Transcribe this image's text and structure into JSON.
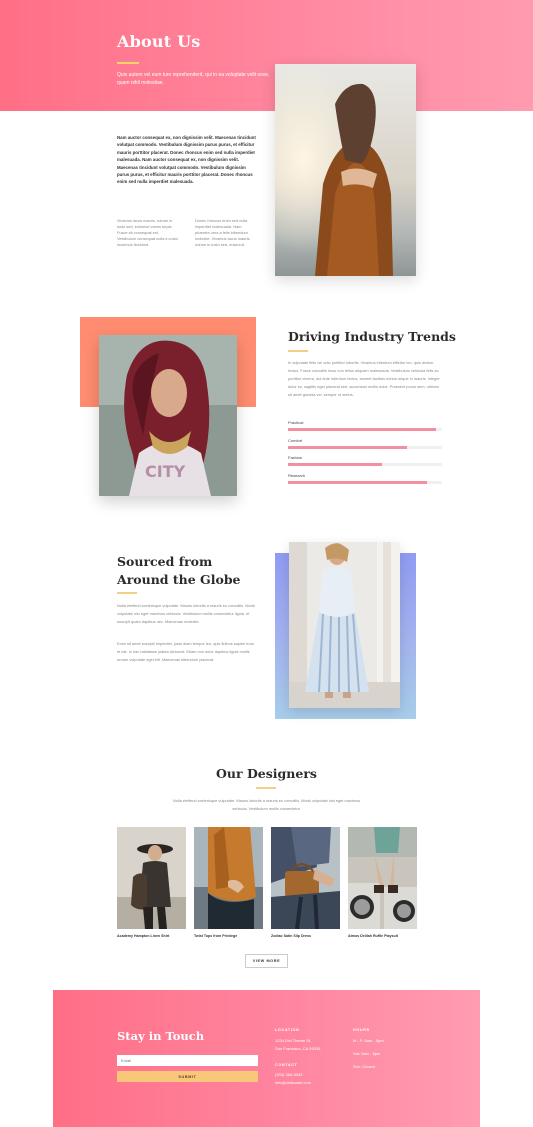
{
  "hero": {
    "title": "About Us",
    "subtitle": "Quis autem vel eum iure reprehenderit, qui in ea voluptate velit esse, quam nihil molestiae."
  },
  "about": {
    "bold_paragraph": "Nam auctor consequat ex, non dignissim velit. Maecenas tincidunt volutpat commodo. Vestibulum dignissim purus purus, et efficitur mauris porttitor placerat. Donec rhoncus enim sed nulla imperdiet malesuada. Nam auctor consequat ex, non dignissim velit. Maecenas tincidunt volutpat commodo. Vestibulum dignissim purus purus, et efficitur mauris porttitor placerat. Donec rhoncus enim sed nulla imperdiet malesuada.",
    "col1": "Vivamus lacus mauris, rutrum in iusto sed, euismod varius turpis. Fusce sit consequat est. Vestibulum consequat nulla in iusto maximus tincidunt.",
    "col2": "Donec rhoncus enim sed nulla imperdiet malesuada. Nam pharetra urna a felis bibendum molestie. Vivamus lacus mauris, rutrum in iusto sed, euismod."
  },
  "trends": {
    "title": "Driving Industry Trends",
    "text": "In vulputate felis vel odio porttitor lobortis. Vivamus interdum efficitur leo, quis dictum lectus. Fusce convallis risus non tellus aliquam malesuada. Vestibulum vehicula felis ac porttitor viverra, dui ante interdum lectus, laoreet facilisis metus neque in mauris. Integer dolor ex, sagittis eget placerat sed, accumsan mollis dolor. Praesent purus sem, ultrices sit amet gravida vel, semper ut metus.",
    "bars": [
      {
        "label": "Practical",
        "value": 0.96
      },
      {
        "label": "Comfort",
        "value": 0.77
      },
      {
        "label": "Fashion",
        "value": 0.61
      },
      {
        "label": "Research",
        "value": 0.9
      }
    ],
    "bar_color": "#f28fa0"
  },
  "sourced": {
    "title": "Sourced from Around the Globe",
    "p1": "Nulla eleifend scelerisque vulputate. Mauris lobortis a mauris eu convallis. Morbi vulputate nisi eget maximus vehicula. Vestibulum mollis consectetur ligula, et suscipit quam dapibus nec. Maecenas molestie.",
    "p2": "Enim sit amet suscipit imperdiet, justo diam tempor leo, quis finibus sapien eros et est. In hac habitasse platea dictumst. Etiam non dolor dapibus ligula mollis ornare vulputate eget elit. Maecenas bibendum placerat."
  },
  "designers": {
    "title": "Our Designers",
    "subtitle": "Nulla eleifend scelerisque vulputate. Mauris lobortis a mauris eu convallis. Morbi vulputate nisi eget maximus vehicula. Vestibulum mollis consectetur.",
    "items": [
      {
        "caption": "Academy Hampton Linen Shirt"
      },
      {
        "caption": "Twist Tops from Privilege"
      },
      {
        "caption": "Zodiac Satin Slip Dress"
      },
      {
        "caption": "Atmos Delilah Ruffle Playsuit"
      }
    ],
    "view_more": "VIEW MORE"
  },
  "footer": {
    "title": "Stay in Touch",
    "email_placeholder": "Email",
    "submit_label": "SUBMIT",
    "location_label": "LOCATION",
    "location_lines": [
      "1234 Divi Theme St.",
      "San Francisco, CA 93035"
    ],
    "contact_label": "CONTACT",
    "contact_lines": [
      "(333) 384-3343",
      "info@divilauder.com"
    ],
    "hours_label": "HOURS",
    "hours_lines": [
      "M - F: 8am - 5pm",
      "Sat: 9am - 8pm",
      "Sun: Closed"
    ]
  },
  "colors": {
    "accent_pink": "#ff7a92",
    "accent_gold": "#f8c77a",
    "accent_coral": "#ff8c70"
  }
}
